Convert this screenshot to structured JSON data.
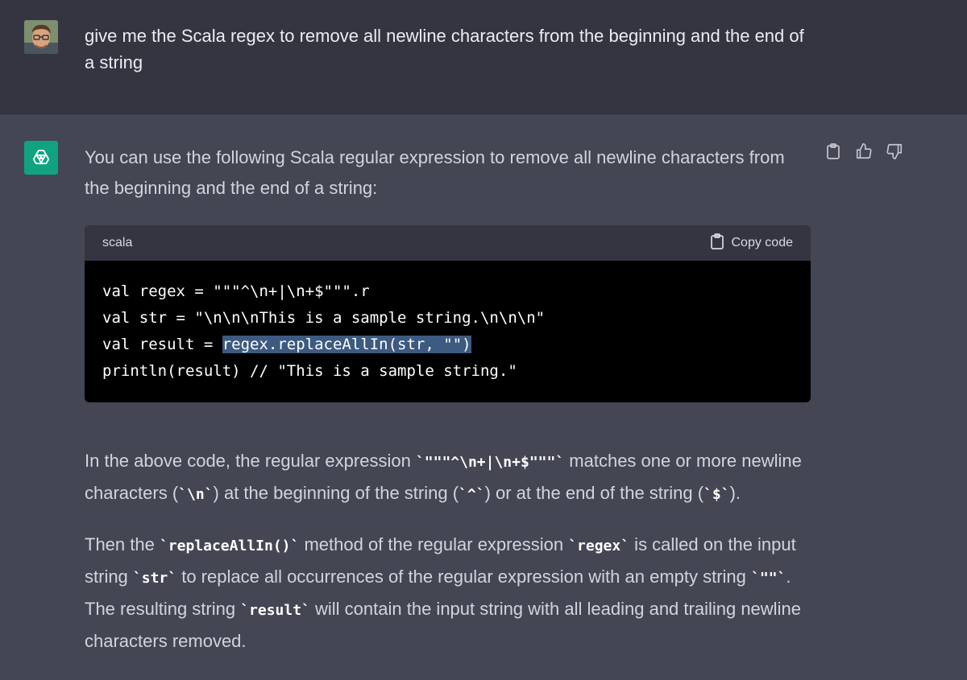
{
  "user": {
    "message": "give me the Scala regex to remove all newline characters from the beginning and the end of a string"
  },
  "assistant": {
    "intro": "You can use the following Scala regular expression to remove all newline characters from the beginning and the end of a string:",
    "code": {
      "language": "scala",
      "copy_label": "Copy code",
      "lines": [
        "val regex = \"\"\"^\\n+|\\n+$\"\"\".r",
        "val str = \"\\n\\n\\nThis is a sample string.\\n\\n\\n\"",
        "val result = ",
        "println(result) // \"This is a sample string.\""
      ],
      "selected": "regex.replaceAllIn(str, \"\")"
    },
    "explanation1": {
      "t1": "In the above code, the regular expression ",
      "c1": "`\"\"\"^\\n+|\\n+$\"\"\"`",
      "t2": " matches one or more newline characters (",
      "c2": "`\\n`",
      "t3": ") at the beginning of the string (",
      "c3": "`^`",
      "t4": ") or at the end of the string (",
      "c4": "`$`",
      "t5": ")."
    },
    "explanation2": {
      "t1": "Then the ",
      "c1": "`replaceAllIn()`",
      "t2": " method of the regular expression ",
      "c2": "`regex`",
      "t3": " is called on the input string ",
      "c3": "`str`",
      "t4": " to replace all occurrences of the regular expression with an empty string ",
      "c4": "`\"\"`",
      "t5": ". The resulting string ",
      "c5": "`result`",
      "t6": " will contain the input string with all leading and trailing newline characters removed."
    }
  },
  "colors": {
    "user_bg": "#343541",
    "assistant_bg": "#444654",
    "brand": "#10a37f",
    "code_bg": "#000000",
    "selection": "#3d5a80"
  },
  "icons": [
    "user-avatar",
    "openai-logo-icon",
    "clipboard-icon",
    "thumbs-up-icon",
    "thumbs-down-icon"
  ]
}
